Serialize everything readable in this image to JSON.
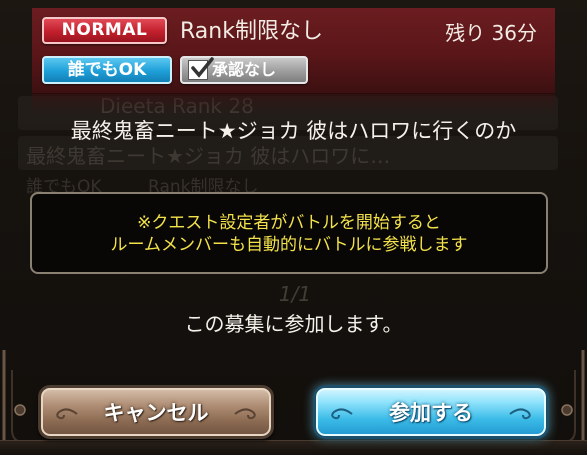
{
  "header": {
    "difficulty_badge": "NORMAL",
    "rank_restriction": "Rank制限なし",
    "time_remaining": "残り 36分",
    "join_condition_badge": "誰でもOK",
    "approval_badge": "承認なし"
  },
  "background": {
    "ghost_name": "Dieeta Rank 28",
    "ghost_title": "最終鬼畜ニート★ジョカ 彼はハロワに…",
    "ghost_badge": "誰でもOK",
    "ghost_rank": "Rank制限なし",
    "ghost_page": "1/1"
  },
  "dialog": {
    "quest_title": "最終鬼畜ニート★ジョカ 彼はハロワに行くのか",
    "notice_line1": "※クエスト設定者がバトルを開始すると",
    "notice_line2": "ルームメンバーも自動的にバトルに参戦します",
    "confirm_message": "この募集に参加します。"
  },
  "buttons": {
    "cancel": "キャンセル",
    "join": "参加する"
  },
  "colors": {
    "header_red": "#5a1619",
    "notice_yellow": "#f3e24b",
    "cancel_brown": "#b08f76",
    "join_blue": "#3bbbe8"
  }
}
